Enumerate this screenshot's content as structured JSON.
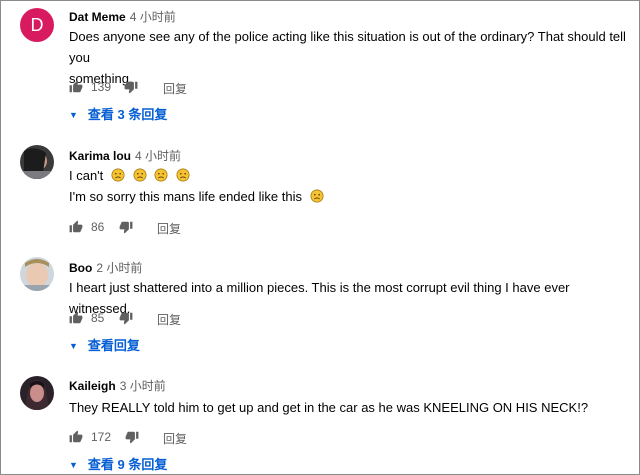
{
  "comments": [
    {
      "author": "Dat Meme",
      "time": "4 小时前",
      "avatar_letter": "D",
      "lines": [
        "Does anyone see any of the police acting like this situation is out of the ordinary? That should tell you",
        "something."
      ],
      "likes": "139",
      "reply_label": "回复",
      "replies_link": "查看 3 条回复"
    },
    {
      "author": "Karima lou",
      "time": "4 小时前",
      "line1_prefix": "I can't",
      "line2": "I'm so sorry this mans life ended like this",
      "likes": "86",
      "reply_label": "回复"
    },
    {
      "author": "Boo",
      "time": "2 小时前",
      "lines": [
        "I heart just shattered into a million pieces. This is the most corrupt evil thing I have ever witnessed."
      ],
      "likes": "85",
      "reply_label": "回复",
      "replies_link": "查看回复"
    },
    {
      "author": "Kaileigh",
      "time": "3 小时前",
      "lines": [
        "They REALLY told him to get up and get in the car as he was KNEELING ON HIS NECK!?"
      ],
      "likes": "172",
      "reply_label": "回复",
      "replies_link": "查看 9 条回复"
    }
  ],
  "icons": {
    "like": "thumb-up-icon",
    "dislike": "thumb-down-icon",
    "expand": "caret-down-icon",
    "emoji": "sad-face-emoji"
  },
  "colors": {
    "link": "#065fd4",
    "avatar_bg": "#d81b60",
    "meta": "#606060"
  }
}
